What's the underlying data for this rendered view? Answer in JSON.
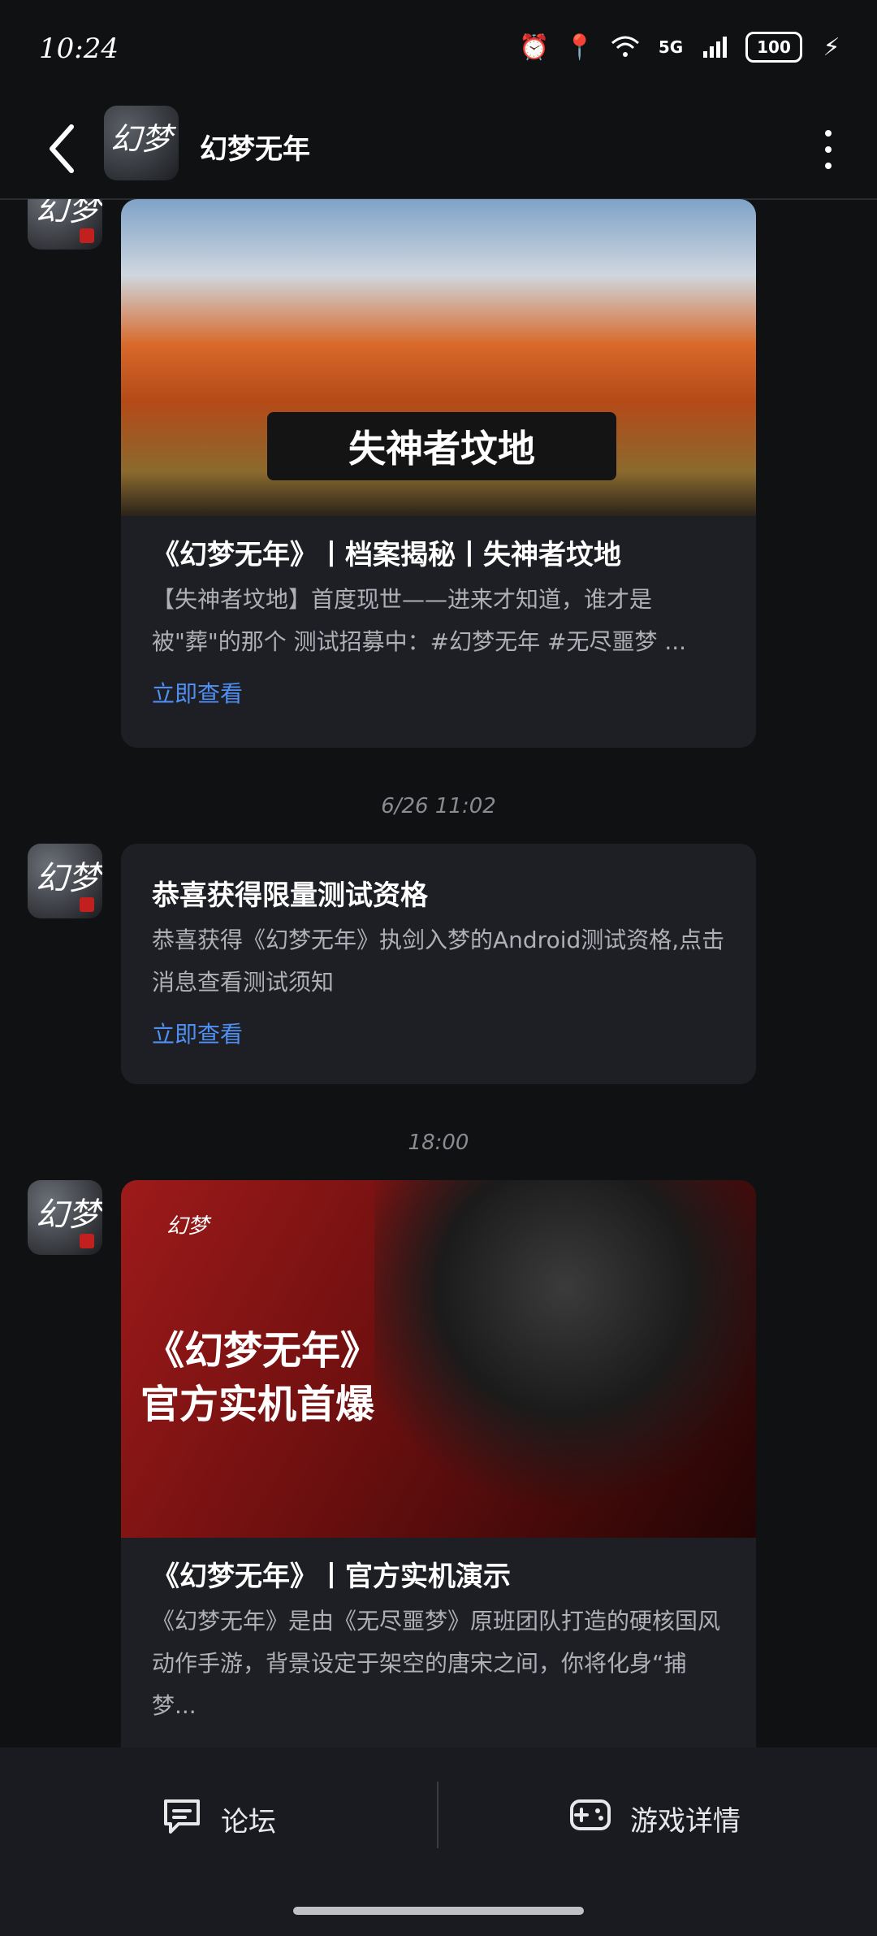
{
  "status": {
    "time": "10:24",
    "network": "5G",
    "battery": "100"
  },
  "header": {
    "title": "幻梦无年"
  },
  "messages": [
    {
      "image_text": "失神者坟地",
      "title": "《幻梦无年》丨档案揭秘丨失神者坟地",
      "desc": "【失神者坟地】首度现世——进来才知道，谁才是被\"葬\"的那个 测试招募中：#幻梦无年 #无尽噩梦 ...",
      "link": "立即查看"
    },
    {
      "timestamp": "6/26 11:02",
      "title": "恭喜获得限量测试资格",
      "desc": "恭喜获得《幻梦无年》执剑入梦的Android测试资格,点击消息查看测试须知",
      "link": "立即查看"
    },
    {
      "timestamp": "18:00",
      "image_text1": "《幻梦无年》",
      "image_text2": "官方实机首爆",
      "title": "《幻梦无年》丨官方实机演示",
      "desc": "《幻梦无年》是由《无尽噩梦》原班团队打造的硬核国风动作手游，背景设定于架空的唐宋之间，你将化身“捕梦..."
    }
  ],
  "bottom_tabs": {
    "forum": "论坛",
    "game_details": "游戏详情"
  },
  "colors": {
    "background": "#101113",
    "card": "#1e1f25",
    "link": "#4f8ff2"
  }
}
